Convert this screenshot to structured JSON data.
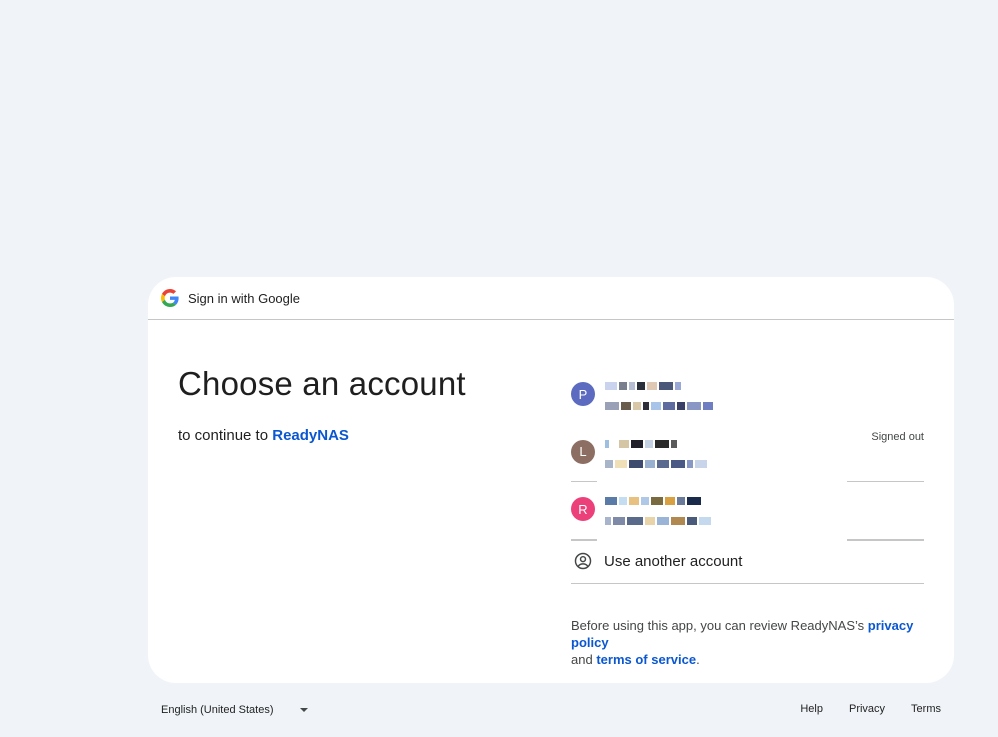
{
  "header": {
    "text": "Sign in with Google",
    "icon": "google-g-icon"
  },
  "main": {
    "title": "Choose an account",
    "subtitle_prefix": "to continue to",
    "app_name": "ReadyNAS"
  },
  "accounts": [
    {
      "initial": "P",
      "avatar_color": "#5c6bc0",
      "status": ""
    },
    {
      "initial": "L",
      "avatar_color": "#8d6e63",
      "status": "Signed out"
    },
    {
      "initial": "R",
      "avatar_color": "#ec407a",
      "status": ""
    }
  ],
  "use_another": {
    "label": "Use another account",
    "icon": "account-circle-icon"
  },
  "disclaimer": {
    "prefix": "Before using this app, you can review ReadyNAS’s",
    "privacy_link": "privacy policy",
    "and": "and",
    "terms_link": "terms of service",
    "suffix": "."
  },
  "footer": {
    "language": "English (United States)",
    "links": {
      "help": "Help",
      "privacy": "Privacy",
      "terms": "Terms"
    }
  },
  "colors": {
    "background": "#f0f4f9",
    "link": "#0b57d0",
    "divider": "#c4c7c5"
  }
}
